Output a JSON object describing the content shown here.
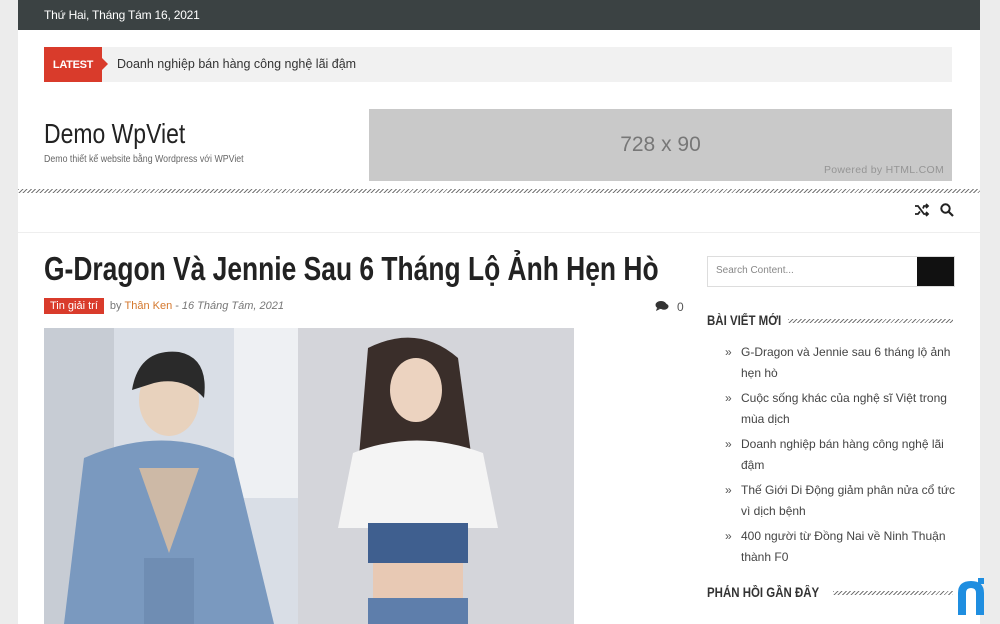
{
  "topbar": {
    "date": "Thứ Hai, Tháng Tám 16, 2021"
  },
  "ticker": {
    "label": "LATEST",
    "headline": "Doanh nghiệp bán hàng công nghệ lãi đậm"
  },
  "header": {
    "site_title": "Demo WpViet",
    "site_description": "Demo thiết kế website bằng Wordpress với WPViet"
  },
  "ad": {
    "size_text": "728 x 90",
    "powered": "Powered by HTML.COM"
  },
  "nav": {
    "icons": [
      "shuffle-icon",
      "search-icon"
    ]
  },
  "post": {
    "title": "G-Dragon Và Jennie Sau 6 Tháng Lộ Ảnh Hẹn Hò",
    "category": "Tin giải trí",
    "by": "by",
    "author": "Thân Ken",
    "separator": "-",
    "date": "16 Tháng Tám, 2021",
    "comment_count": "0"
  },
  "sidebar": {
    "search_placeholder": "Search Content...",
    "recent_title": "BÀI VIẾT MỚI",
    "recent_posts": [
      "G-Dragon và Jennie sau 6 tháng lộ ảnh hẹn hò",
      "Cuộc sống khác của nghệ sĩ Việt trong mùa dịch",
      "Doanh nghiệp bán hàng công nghệ lãi đậm",
      "Thế Giới Di Động giảm phân nửa cổ tức vì dịch bệnh",
      "400 người từ Đồng Nai về Ninh Thuận thành F0"
    ],
    "comments_title": "PHẢN HỒI GẦN ĐÂY"
  },
  "colors": {
    "accent": "#d93b2b",
    "topbar": "#3b4243",
    "author": "#d4772c"
  }
}
